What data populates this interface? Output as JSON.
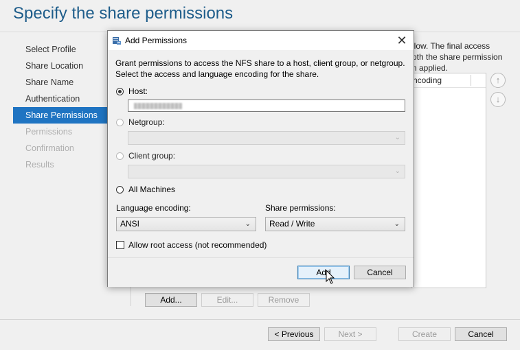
{
  "wizard": {
    "title": "Specify the share permissions",
    "nav": [
      {
        "label": "Select Profile",
        "state": "normal"
      },
      {
        "label": "Share Location",
        "state": "normal"
      },
      {
        "label": "Share Name",
        "state": "normal"
      },
      {
        "label": "Authentication",
        "state": "normal"
      },
      {
        "label": "Share Permissions",
        "state": "active"
      },
      {
        "label": "Permissions",
        "state": "disabled"
      },
      {
        "label": "Confirmation",
        "state": "disabled"
      },
      {
        "label": "Results",
        "state": "disabled"
      }
    ],
    "bg_text_line1": "llow. The final access",
    "bg_text_line2": "oth the share permission",
    "bg_text_line3": "n applied.",
    "list_header": "ncoding",
    "up_icon": "arrow-up-circle-icon",
    "down_icon": "arrow-down-circle-icon",
    "list_buttons": {
      "add": "Add...",
      "edit": "Edit...",
      "remove": "Remove"
    },
    "footer_buttons": {
      "previous": "< Previous",
      "next": "Next >",
      "create": "Create",
      "cancel": "Cancel"
    }
  },
  "dialog": {
    "title": "Add Permissions",
    "description_line1": "Grant permissions to access the NFS share to a host, client group, or netgroup.",
    "description_line2": "Select the access and language encoding for the share.",
    "options": {
      "host": "Host:",
      "netgroup": "Netgroup:",
      "client_group": "Client group:",
      "all_machines": "All Machines"
    },
    "selected_option": "host",
    "language_encoding_label": "Language encoding:",
    "language_encoding_value": "ANSI",
    "share_permissions_label": "Share permissions:",
    "share_permissions_value": "Read / Write",
    "allow_root_label": "Allow root access (not recommended)",
    "allow_root_checked": false,
    "add_button": "Add",
    "cancel_button": "Cancel"
  },
  "colors": {
    "accent": "#1f74c2",
    "title": "#1d5c8a"
  }
}
